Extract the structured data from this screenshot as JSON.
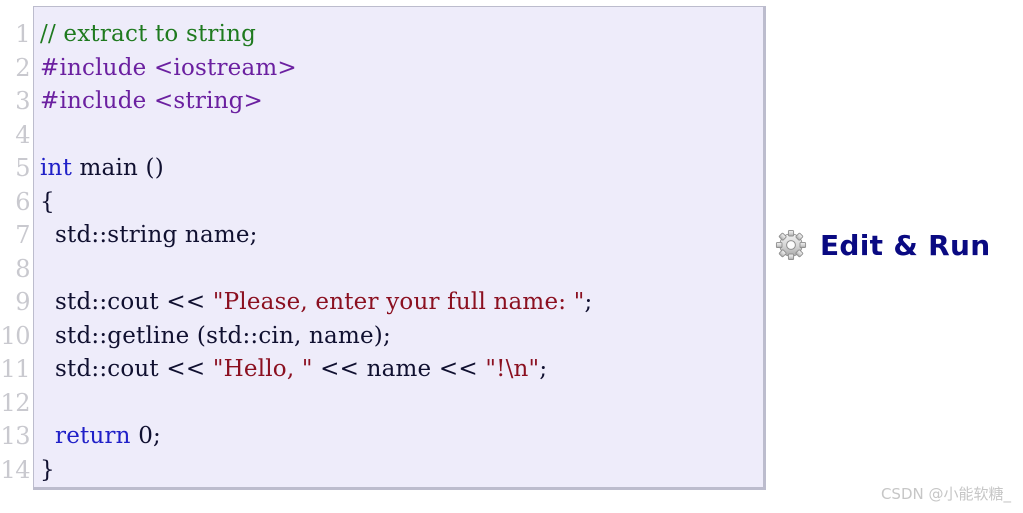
{
  "code_viewer": {
    "language": "cpp",
    "background_color": "#eeecfa",
    "border_color": "#bcbccd",
    "line_numbers": [
      "1",
      "2",
      "3",
      "4",
      "5",
      "6",
      "7",
      "8",
      "9",
      "10",
      "11",
      "12",
      "13",
      "14"
    ],
    "lines": [
      {
        "number": "1",
        "text": "// extract to string",
        "tokens": [
          {
            "t": "// extract to string",
            "c": "comment"
          }
        ]
      },
      {
        "number": "2",
        "text": "#include <iostream>",
        "tokens": [
          {
            "t": "#include",
            "c": "pre"
          },
          {
            "t": " ",
            "c": "plain"
          },
          {
            "t": "<iostream>",
            "c": "header"
          }
        ]
      },
      {
        "number": "3",
        "text": "#include <string>",
        "tokens": [
          {
            "t": "#include",
            "c": "pre"
          },
          {
            "t": " ",
            "c": "plain"
          },
          {
            "t": "<string>",
            "c": "header"
          }
        ]
      },
      {
        "number": "4",
        "text": "",
        "tokens": []
      },
      {
        "number": "5",
        "text": "int main ()",
        "tokens": [
          {
            "t": "int",
            "c": "kw"
          },
          {
            "t": " main ()",
            "c": "plain"
          }
        ]
      },
      {
        "number": "6",
        "text": "{",
        "tokens": [
          {
            "t": "{",
            "c": "plain"
          }
        ]
      },
      {
        "number": "7",
        "text": "  std::string name;",
        "tokens": [
          {
            "t": "  std::string name;",
            "c": "plain"
          }
        ]
      },
      {
        "number": "8",
        "text": "",
        "tokens": []
      },
      {
        "number": "9",
        "text": "  std::cout << \"Please, enter your full name: \";",
        "tokens": [
          {
            "t": "  std::cout << ",
            "c": "plain"
          },
          {
            "t": "\"Please, enter your full name: \"",
            "c": "str"
          },
          {
            "t": ";",
            "c": "plain"
          }
        ]
      },
      {
        "number": "10",
        "text": "  std::getline (std::cin, name);",
        "tokens": [
          {
            "t": "  std::getline (std::cin, name);",
            "c": "plain"
          }
        ]
      },
      {
        "number": "11",
        "text": "  std::cout << \"Hello, \" << name << \"!\\n\";",
        "tokens": [
          {
            "t": "  std::cout << ",
            "c": "plain"
          },
          {
            "t": "\"Hello, \"",
            "c": "str"
          },
          {
            "t": " << name << ",
            "c": "plain"
          },
          {
            "t": "\"!\\n\"",
            "c": "str"
          },
          {
            "t": ";",
            "c": "plain"
          }
        ]
      },
      {
        "number": "12",
        "text": "",
        "tokens": []
      },
      {
        "number": "13",
        "text": "  return 0;",
        "tokens": [
          {
            "t": "  ",
            "c": "plain"
          },
          {
            "t": "return",
            "c": "kw"
          },
          {
            "t": " 0;",
            "c": "plain"
          }
        ]
      },
      {
        "number": "14",
        "text": "}",
        "tokens": [
          {
            "t": "}",
            "c": "plain"
          }
        ]
      }
    ],
    "token_colors": {
      "comment": "#1f7a1f",
      "pre": "#6b20a0",
      "header": "#6b20a0",
      "kw": "#2020c8",
      "str": "#8b1020",
      "plain": "#101030"
    }
  },
  "edit_run": {
    "label": "Edit & Run",
    "icon": "gear-icon",
    "text_color": "#0a0a82"
  },
  "watermark": {
    "text": "CSDN @小能软糖_",
    "color": "#c6c6c6"
  }
}
